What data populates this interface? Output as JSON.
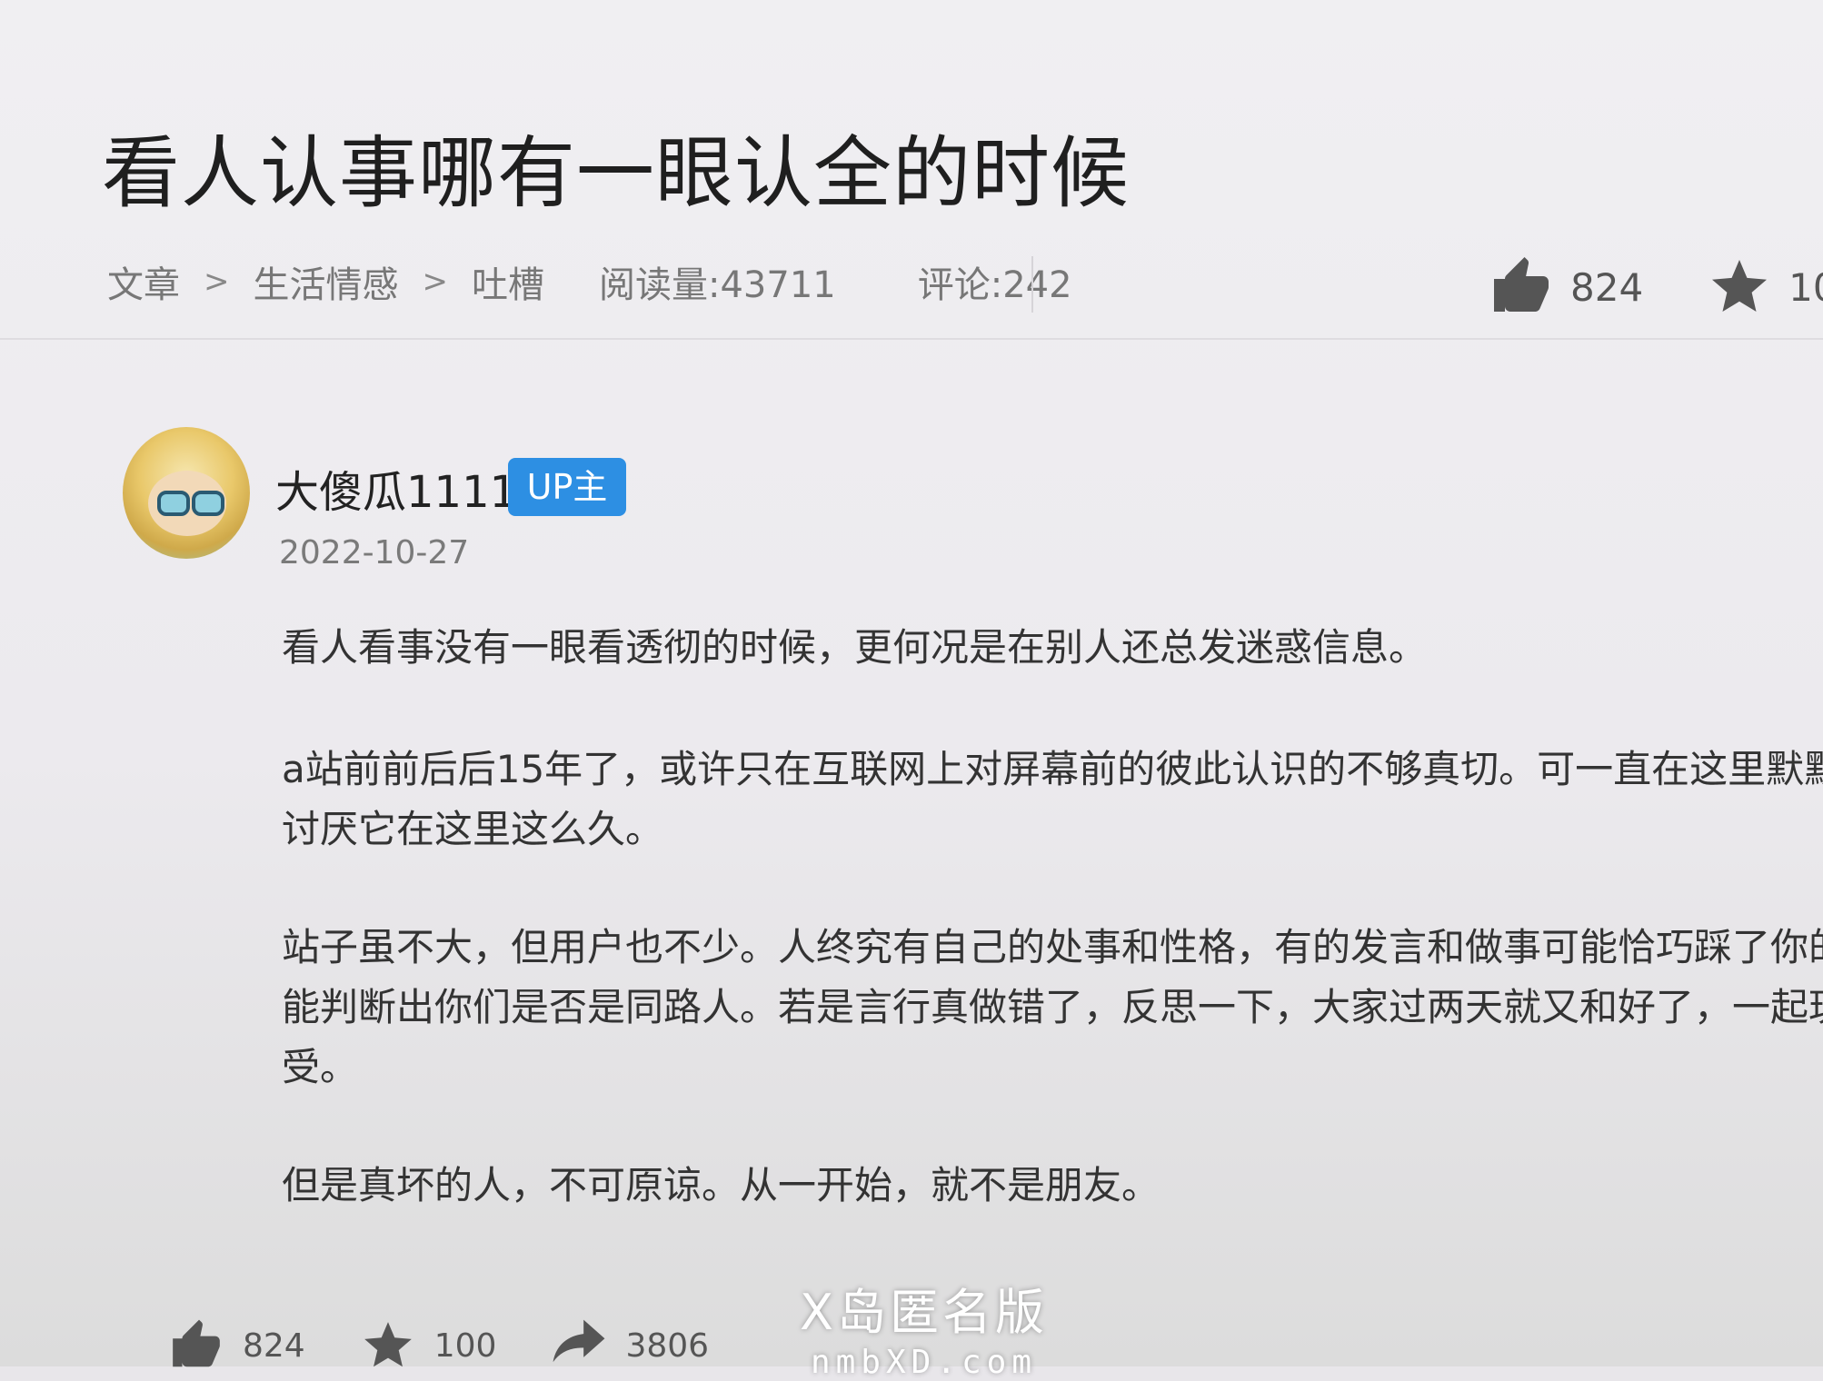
{
  "article": {
    "title": "看人认事哪有一眼认全的时候",
    "breadcrumb": [
      "文章",
      "生活情感",
      "吐槽"
    ],
    "breadcrumb_separator": ">",
    "views": "阅读量:43711",
    "comments": "评论:242",
    "like_count": "824",
    "favorite_count": "10"
  },
  "author": {
    "name": "大傻瓜1111",
    "badge": "UP主",
    "date": "2022-10-27"
  },
  "content": {
    "p1": "看人看事没有一眼看透彻的时候，更何况是在别人还总发迷惑信息。",
    "p2_line1": "a站前前后后15年了，或许只在互联网上对屏幕前的彼此认识的不够真切。可一直在这里默默付",
    "p2_line2": "讨厌它在这里这么久。",
    "p3_line1": "站子虽不大，但用户也不少。人终究有自己的处事和性格，有的发言和做事可能恰巧踩了你的雷",
    "p3_line2": "能判断出你们是否是同路人。若是言行真做错了，反思一下，大家过两天就又和好了，一起玩的",
    "p3_line3": "受。",
    "p4": "但是真坏的人，不可原谅。从一开始，就不是朋友。"
  },
  "footer": {
    "like_count": "824",
    "favorite_count": "100",
    "share_count": "3806"
  },
  "watermark": {
    "line1": "X岛匿名版",
    "line2": "nmbXD.com"
  },
  "colors": {
    "badge_bg": "#2d8fe3",
    "icon": "#555555"
  }
}
